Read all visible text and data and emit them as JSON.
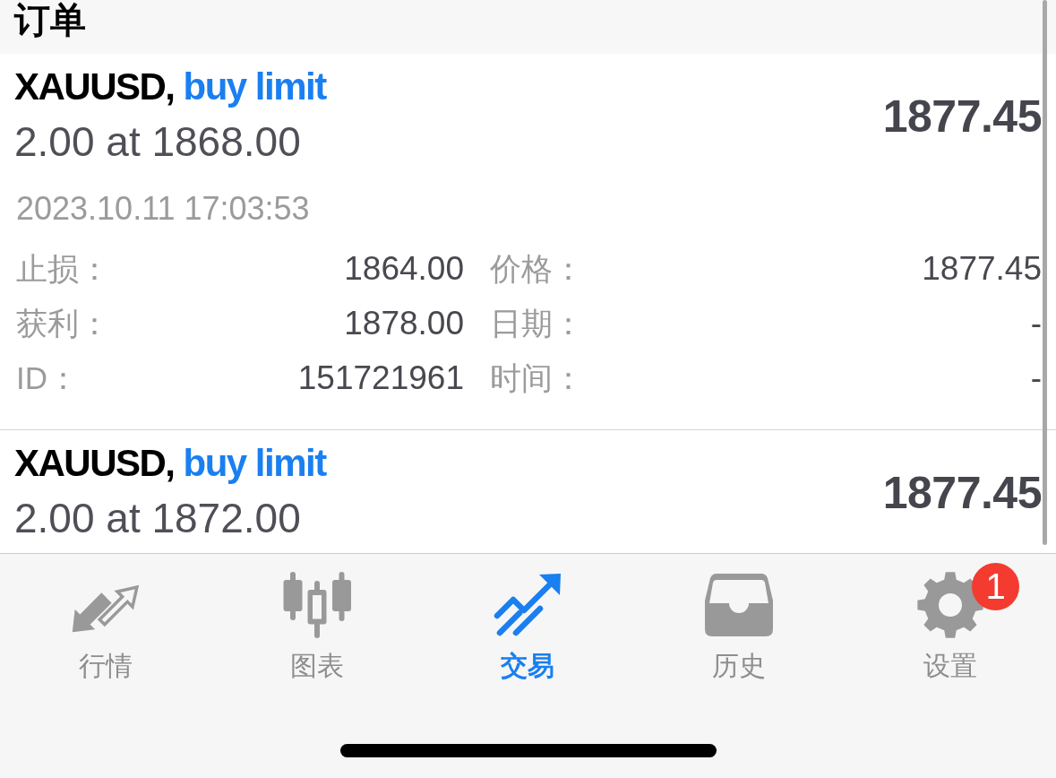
{
  "header": {
    "title": "订单"
  },
  "orders": [
    {
      "symbol": "XAUUSD,",
      "type": "buy limit",
      "volume_price": "2.00 at 1868.00",
      "current_price": "1877.45",
      "expanded": true,
      "time": "2023.10.11 17:03:53",
      "details": [
        {
          "label": "止损：",
          "value": "1864.00"
        },
        {
          "label": "价格：",
          "value": "1877.45"
        },
        {
          "label": "获利：",
          "value": "1878.00"
        },
        {
          "label": "日期：",
          "value": "-"
        },
        {
          "label": "ID：",
          "value": "151721961"
        },
        {
          "label": "时间：",
          "value": "-"
        }
      ]
    },
    {
      "symbol": "XAUUSD,",
      "type": "buy limit",
      "volume_price": "2.00 at 1872.00",
      "current_price": "1877.45",
      "expanded": false
    }
  ],
  "tabs": [
    {
      "label": "行情",
      "selected": false
    },
    {
      "label": "图表",
      "selected": false
    },
    {
      "label": "交易",
      "selected": true
    },
    {
      "label": "历史",
      "selected": false
    },
    {
      "label": "设置",
      "selected": false,
      "badge": "1"
    }
  ]
}
